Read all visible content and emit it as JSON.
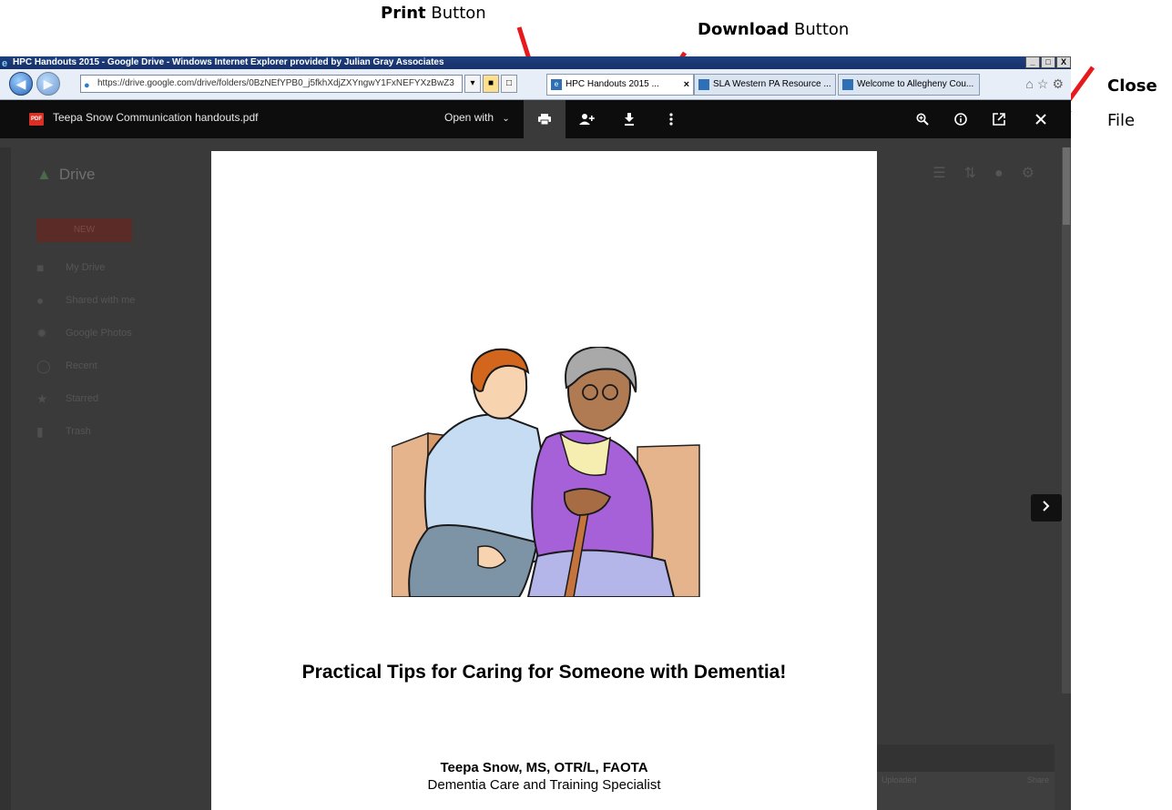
{
  "annotations": {
    "print": {
      "bold": "Print",
      "rest": " Button"
    },
    "download": {
      "bold": "Download",
      "rest": " Button"
    },
    "close": {
      "bold": "Close",
      "rest": "File"
    },
    "arrow_color": "#e8191d"
  },
  "browser": {
    "title": "HPC Handouts 2015 - Google Drive - Windows Internet Explorer provided by Julian Gray Associates",
    "address": "https://drive.google.com/drive/folders/0BzNEfYPB0_j5fkhXdjZXYngwY1FxNEFYXzBwZ3",
    "tabs": [
      {
        "label": "HPC Handouts 2015 ...",
        "active": true
      },
      {
        "label": "SLA Western PA Resource ...",
        "active": false
      },
      {
        "label": "Welcome to Allegheny Cou...",
        "active": false
      }
    ],
    "window_controls": [
      "_",
      "□",
      "X"
    ]
  },
  "drive": {
    "logo": "Drive",
    "new_label": "NEW",
    "nav": [
      "My Drive",
      "Shared with me",
      "Google Photos",
      "Recent",
      "Starred",
      "Trash"
    ],
    "upload_cols": [
      "Uploaded",
      "Share"
    ]
  },
  "viewer": {
    "file_name": "Teepa Snow Communication handouts.pdf",
    "open_with": "Open with",
    "pdf_badge": "PDF"
  },
  "document": {
    "title": "Practical Tips for Caring for Someone with Dementia!",
    "author": "Teepa Snow, MS, OTR/L, FAOTA",
    "role": "Dementia Care and Training Specialist"
  }
}
